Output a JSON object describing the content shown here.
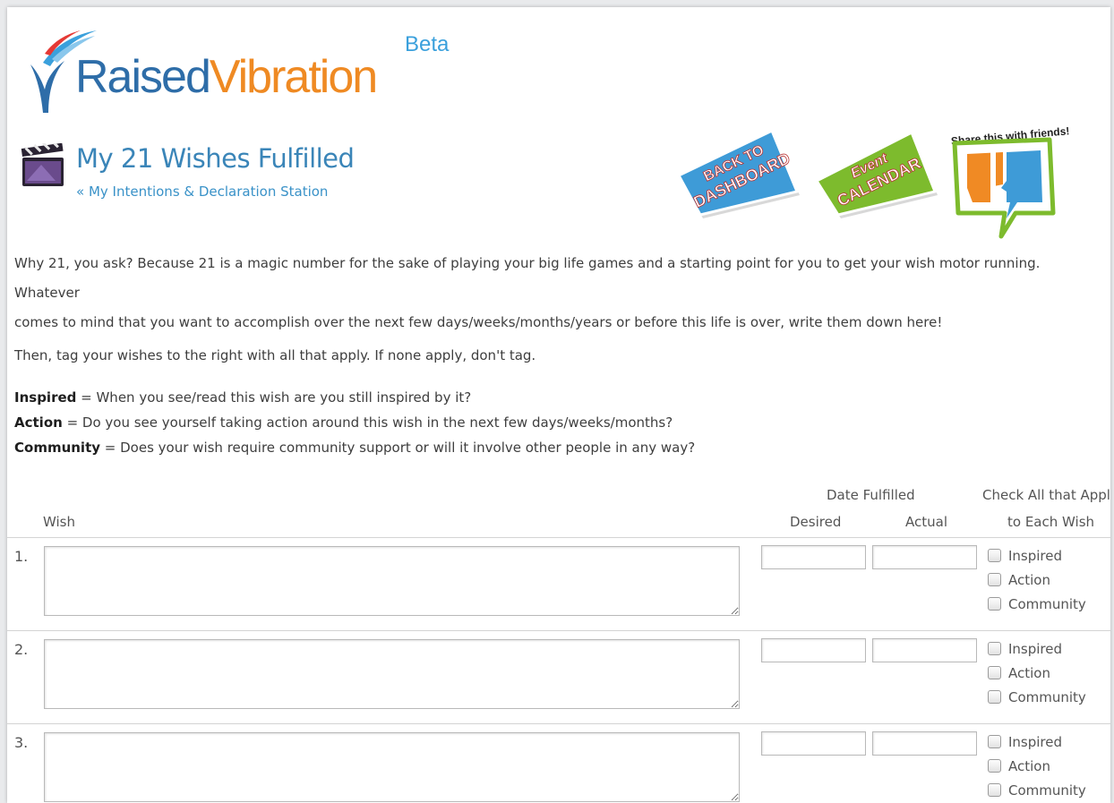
{
  "logo": {
    "raised": "Raised",
    "vibration": "Vibration",
    "beta": "Beta"
  },
  "header": {
    "title": "My 21 Wishes Fulfilled",
    "breadcrumb": "« My Intentions & Declaration Station"
  },
  "badges": {
    "dashboard": {
      "line1": "BACK TO",
      "line2": "DASHBOARD",
      "color": "#3e9bd7"
    },
    "calendar": {
      "line1": "Event",
      "line2": "CALENDAR",
      "color": "#7dbb2d"
    },
    "share": {
      "label": "Share this with friends!"
    }
  },
  "intro": {
    "p1_line1": "Why 21, you ask? Because 21 is a magic number for the sake of playing your big life games and a starting point for you to get your wish motor running. Whatever",
    "p1_line2": "comes to mind that you want to accomplish over the next few days/weeks/months/years or before this life is over, write them down here!",
    "p2": "Then, tag your wishes to the right with all that apply. If none apply, don't tag."
  },
  "legend": [
    {
      "term": "Inspired",
      "def": " = When you see/read this wish are you still inspired by it?"
    },
    {
      "term": "Action",
      "def": " = Do you see yourself taking action around this wish in the next few days/weeks/months?"
    },
    {
      "term": "Community",
      "def": " = Does your wish require community support or will it involve other people in any way?"
    }
  ],
  "table": {
    "wish_header": "Wish",
    "date_header": "Date Fulfilled",
    "desired_header": "Desired",
    "actual_header": "Actual",
    "check_header": "Check All that Apply",
    "check_header2": "to Each Wish",
    "rows": [
      {
        "number": "1.",
        "wish": "",
        "desired": "",
        "actual": "",
        "inspired": "Inspired",
        "action": "Action",
        "community": "Community"
      },
      {
        "number": "2.",
        "wish": "",
        "desired": "",
        "actual": "",
        "inspired": "Inspired",
        "action": "Action",
        "community": "Community"
      },
      {
        "number": "3.",
        "wish": "",
        "desired": "",
        "actual": "",
        "inspired": "Inspired",
        "action": "Action",
        "community": "Community"
      }
    ]
  }
}
